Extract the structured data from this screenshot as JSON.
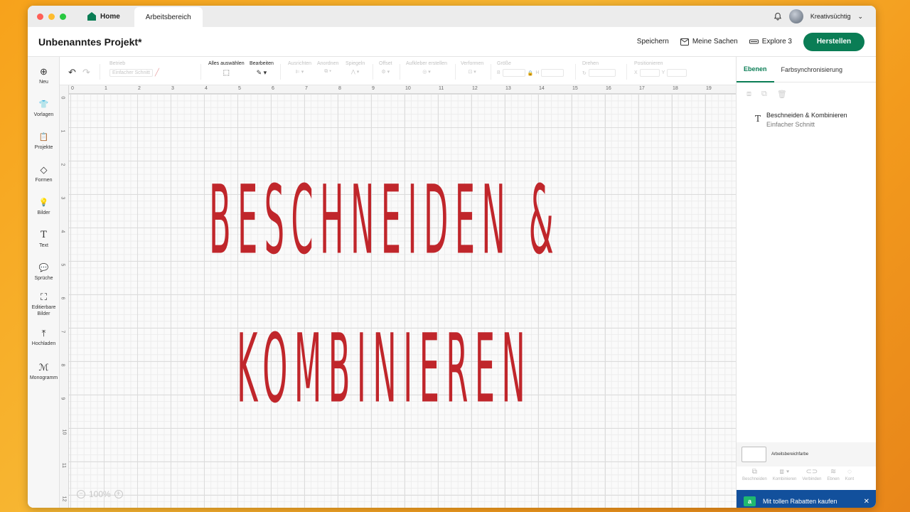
{
  "tabs": {
    "home": "Home",
    "active": "Arbeitsbereich",
    "user": "Kreativsüchtig"
  },
  "header": {
    "project_title": "Unbenanntes Projekt*",
    "save": "Speichern",
    "my_stuff": "Meine Sachen",
    "machine": "Explore 3",
    "make": "Herstellen"
  },
  "sidebar": {
    "items": [
      {
        "label": "Neu",
        "icon": "plus-circle-icon",
        "glyph": "⊕"
      },
      {
        "label": "Vorlagen",
        "icon": "shirt-icon",
        "glyph": "👕"
      },
      {
        "label": "Projekte",
        "icon": "clipboard-icon",
        "glyph": "📋"
      },
      {
        "label": "Formen",
        "icon": "shapes-icon",
        "glyph": "◇"
      },
      {
        "label": "Bilder",
        "icon": "lightbulb-icon",
        "glyph": "💡"
      },
      {
        "label": "Text",
        "icon": "text-icon",
        "glyph": "T"
      },
      {
        "label": "Sprüche",
        "icon": "speech-bubble-icon",
        "glyph": "💬"
      },
      {
        "label": "Editierbare Bilder",
        "icon": "editable-image-icon",
        "glyph": "⛶"
      },
      {
        "label": "Hochladen",
        "icon": "upload-icon",
        "glyph": "⤒"
      },
      {
        "label": "Monogramm",
        "icon": "monogram-icon",
        "glyph": "ℳ"
      }
    ]
  },
  "toolbar": {
    "operation_label": "Betrieb",
    "operation_value": "Einfacher Schnitt",
    "select_all": "Alles auswählen",
    "edit": "Bearbeiten",
    "align": "Ausrichten",
    "arrange": "Anordnen",
    "flip": "Spiegeln",
    "offset": "Offset",
    "sticker": "Aufkleber erstellen",
    "warp": "Verformen",
    "size": "Größe",
    "size_w": "B",
    "size_h": "H",
    "rotate": "Drehen",
    "position": "Positionieren",
    "pos_x": "X",
    "pos_y": "Y"
  },
  "canvas": {
    "design_line1": "BESCHNEIDEN &",
    "design_line2": "KOMBINIEREN",
    "design_color": "#c0262b",
    "zoom": "100%",
    "ruler_x": [
      "0",
      "1",
      "2",
      "3",
      "4",
      "5",
      "6",
      "7",
      "8",
      "9",
      "10",
      "11",
      "12",
      "13",
      "14",
      "15",
      "16",
      "17",
      "18",
      "19"
    ],
    "ruler_y": [
      "0",
      "1",
      "2",
      "3",
      "4",
      "5",
      "6",
      "7",
      "8",
      "9",
      "10",
      "11",
      "12"
    ]
  },
  "rpanel": {
    "tab_layers": "Ebenen",
    "tab_sync": "Farbsynchronisierung",
    "layer_name": "Beschneiden & Kombinieren",
    "layer_sub": "Einfacher Schnitt",
    "bg_color": "Arbeitsbereichfarbe",
    "actions": [
      "Beschneiden",
      "Kombinieren",
      "Verbinden",
      "Ebnen",
      "Kont"
    ],
    "promo": "Mit tollen Rabatten kaufen"
  },
  "colors": {
    "accent": "#0a7d55",
    "promo_bg": "#12509c"
  }
}
